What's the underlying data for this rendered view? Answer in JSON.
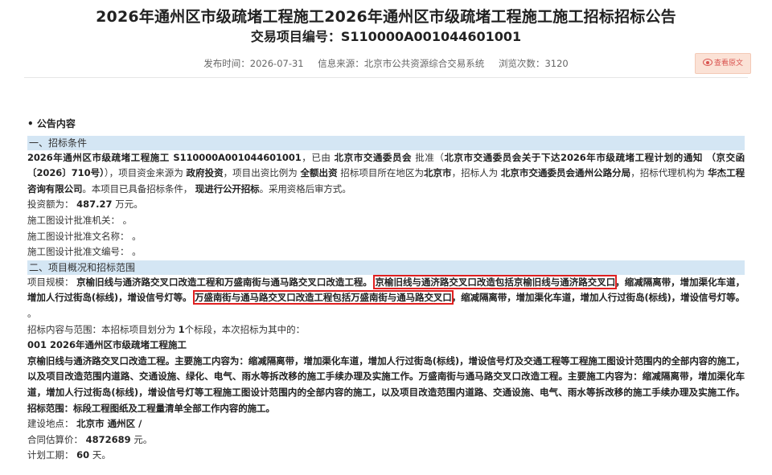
{
  "header": {
    "title": "2026年通州区市级疏堵工程施工2026年通州区市级疏堵工程施工施工招标招标公告",
    "subtitle": "交易项目编号：S110000A001044601001",
    "publish_label": "发布时间：",
    "publish_time": "2026-07-31",
    "source_label": "信息来源：",
    "source": "北京市公共资源综合交易系统",
    "views_label": "浏览次数：",
    "views": "3120",
    "view_original": "查看原文"
  },
  "section_title": "• 公告内容",
  "sections": {
    "s1": "一、招标条件",
    "s2": "二、项目概况和招标范围"
  },
  "s1_para": {
    "p1": "2026年通州区市级疏堵工程施工 S110000A001044601001",
    "p2": "，已由",
    "p3": "北京市交通委员会",
    "p4": "批准（",
    "p5": "北京市交通委员会关于下达2026年市级疏堵工程计划的通知 （京交函〔2026〕710号）",
    "p6": "），项目资金来源为",
    "p7": "政府投资",
    "p8": "，项目出资比例为",
    "p9": "全额出资",
    "p10": "招标项目所在地区为",
    "p11": "北京市",
    "p12": "，招标人为",
    "p13": "北京市交通委员会通州公路分局",
    "p14": "，招标代理机构为",
    "p15": "华杰工程咨询有限公司",
    "p16": "。本项目已具备招标条件，",
    "p17": "现进行公开招标",
    "p18": "。采用资格后审方式。"
  },
  "fields": {
    "invest_label": "投资额为：",
    "invest_value": "487.27",
    "invest_unit": "万元。",
    "approve_org": "施工图设计批准机关：  。",
    "approve_name": "施工图设计批准文名称：  。",
    "approve_no": "施工图设计批准文编号：  。"
  },
  "s2_para": {
    "scale_label": "项目规模：",
    "scale_a": "京榆旧线与通济路交叉口改造工程和万盛南街与通马路交叉口改造工程。",
    "hl1": "京榆旧线与通济路交叉口改造包括京榆旧线与通济路交叉口",
    "scale_b": "，缩减隔离带，增加渠化车道，增加人行过街岛(标线)，增设信号灯等。",
    "hl2": "万盛南街与通马路交叉口改造工程包括万盛南街与通马路交叉口",
    "scale_c": "，缩减隔离带，增加渠化车道，增加人行过街岛(标线)，增设信号灯等。",
    "scale_d": "。"
  },
  "scope": {
    "intro_a": "招标内容与范围：本招标项目划分为",
    "intro_count": "1",
    "intro_b": "个标段，本次招标为其中的：",
    "lot": "001 2026年通州区市级疏堵工程施工",
    "desc": "京榆旧线与通济路交叉口改造工程。主要施工内容为：缩减隔离带，增加渠化车道，增加人行过街岛(标线)，增设信号灯及交通工程等工程施工图设计范围内的全部内容的施工，以及项目改造范围内道路、交通设施、绿化、电气、雨水等拆改移的施工手续办理及实施工作。万盛南街与通马路交叉口改造工程。主要施工内容为：缩减隔离带，增加渠化车道，增加人行过街岛(标线)，增设信号灯等工程施工图设计范围内的全部内容的施工，以及项目改造范围内道路、交通设施、电气、雨水等拆改移的施工手续办理及实施工作。",
    "range": "招标范围：标段工程图纸及工程量清单全部工作内容的施工。",
    "site_label": "建设地点：",
    "site_value": "北京市 通州区 /",
    "price_label": "合同估算价：",
    "price_value": "4872689",
    "price_unit": "元。",
    "period_label": "计划工期：",
    "period_value": "60",
    "period_unit": "天。"
  }
}
